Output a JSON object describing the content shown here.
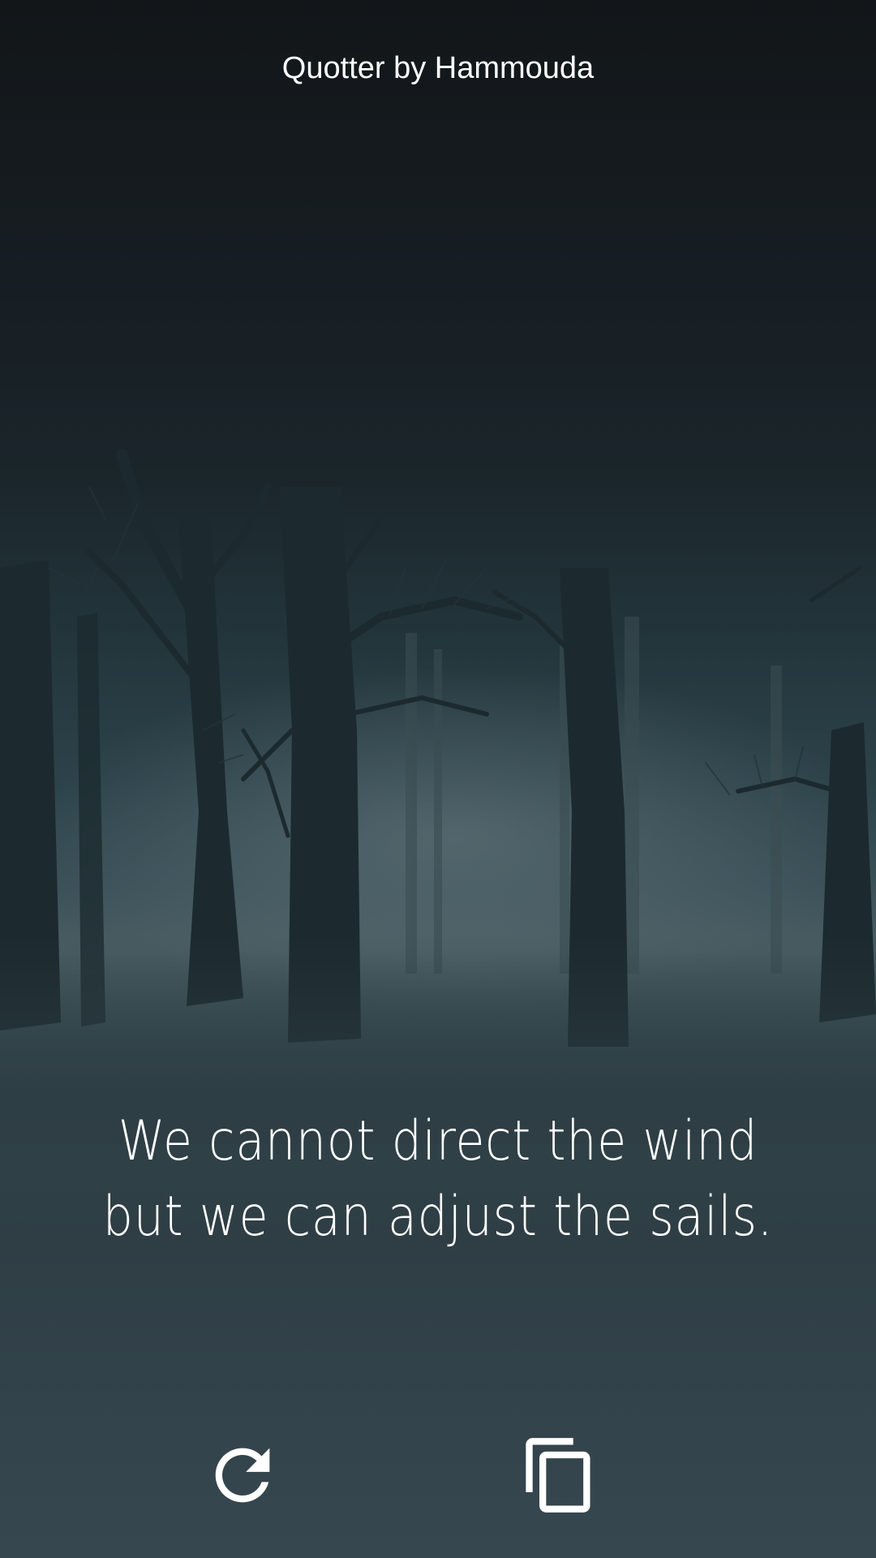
{
  "header": {
    "app_title": "Quotter by Hammouda"
  },
  "quote": {
    "text": "We cannot direct the wind but we can adjust the sails."
  },
  "actions": {
    "refresh_icon": "refresh-icon",
    "copy_icon": "content-copy-icon"
  },
  "colors": {
    "text": "#ffffff",
    "background_top": "#121619",
    "background_bottom": "#37474f",
    "fog": "#4a5d63"
  }
}
